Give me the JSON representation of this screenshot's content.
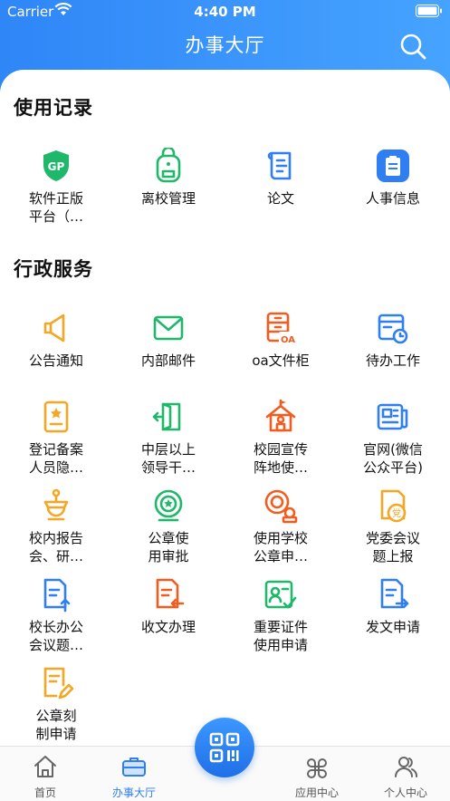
{
  "status_bar": {
    "carrier": "Carrier",
    "time": "4:40 PM"
  },
  "header": {
    "title": "办事大厅",
    "search_icon": "search-icon"
  },
  "sections": {
    "recent": {
      "title": "使用记录",
      "items": [
        {
          "label": "软件正版\n平台（…",
          "icon": "gp-shield-icon",
          "color": "#1fb86b"
        },
        {
          "label": "离校管理",
          "icon": "backpack-icon",
          "color": "#1fb86b"
        },
        {
          "label": "论文",
          "icon": "paper-scroll-icon",
          "color": "#2f7ff2"
        },
        {
          "label": "人事信息",
          "icon": "clipboard-icon",
          "color": "#2f7ff2"
        }
      ]
    },
    "admin": {
      "title": "行政服务",
      "items": [
        {
          "label": "公告通知",
          "icon": "megaphone-icon",
          "color": "#f5a623"
        },
        {
          "label": "内部邮件",
          "icon": "mail-icon",
          "color": "#1fb86b"
        },
        {
          "label": "oa文件柜",
          "icon": "oa-cabinet-icon",
          "color": "#f25c1f"
        },
        {
          "label": "待办工作",
          "icon": "calendar-clock-icon",
          "color": "#2f7ff2"
        },
        {
          "label": "登记备案\n人员隐…",
          "icon": "register-card-icon",
          "color": "#f5a623"
        },
        {
          "label": "中层以上\n领导干…",
          "icon": "door-exit-icon",
          "color": "#1fb86b"
        },
        {
          "label": "校园宣传\n阵地使…",
          "icon": "campus-house-icon",
          "color": "#f25c1f"
        },
        {
          "label": "官网(微信\n公众平台)",
          "icon": "news-icon",
          "color": "#2f7ff2"
        },
        {
          "label": "校内报告\n会、研…",
          "icon": "lectern-icon",
          "color": "#f5a623"
        },
        {
          "label": "公章使\n用审批",
          "icon": "seal-star-icon",
          "color": "#1fb86b"
        },
        {
          "label": "使用学校\n公章申…",
          "icon": "seal-stamp-icon",
          "color": "#f25c1f"
        },
        {
          "label": "党委会议\n题上报",
          "icon": "party-doc-icon",
          "color": "#f5a623"
        },
        {
          "label": "校长办公\n会议题…",
          "icon": "doc-upload-icon",
          "color": "#2f7ff2"
        },
        {
          "label": "收文办理",
          "icon": "doc-receive-icon",
          "color": "#f25c1f"
        },
        {
          "label": "重要证件\n使用申请",
          "icon": "id-card-check-icon",
          "color": "#1fb86b"
        },
        {
          "label": "发文申请",
          "icon": "doc-send-icon",
          "color": "#2f7ff2"
        },
        {
          "label": "公章刻\n制申请",
          "icon": "doc-edit-icon",
          "color": "#f5a623"
        }
      ]
    }
  },
  "tabbar": {
    "items": [
      {
        "label": "首页",
        "icon": "home-icon",
        "active": false
      },
      {
        "label": "办事大厅",
        "icon": "briefcase-icon",
        "active": true
      },
      {
        "label": "应用中心",
        "icon": "apps-icon",
        "active": false
      },
      {
        "label": "个人中心",
        "icon": "user-icon",
        "active": false
      }
    ],
    "center_button_icon": "qr-code-icon"
  },
  "colors": {
    "brand": "#2f86f7",
    "green": "#1fb86b",
    "orange": "#f5a623",
    "red": "#f25c1f",
    "blue": "#2f7ff2"
  }
}
